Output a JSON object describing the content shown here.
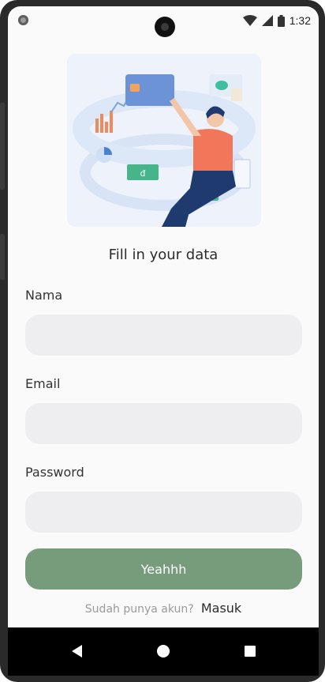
{
  "status_bar": {
    "time": "1:32",
    "icons": [
      "wifi-icon",
      "signal-icon",
      "battery-icon"
    ]
  },
  "form": {
    "title": "Fill in your data",
    "fields": [
      {
        "label": "Nama",
        "value": "",
        "placeholder": ""
      },
      {
        "label": "Email",
        "value": "",
        "placeholder": ""
      },
      {
        "label": "Password",
        "value": "",
        "placeholder": ""
      }
    ],
    "submit_label": "Yeahhh",
    "login_prompt": "Sudah punya akun?",
    "login_link": "Masuk"
  },
  "colors": {
    "accent": "#769c7c",
    "input_bg": "#eeeef1",
    "background": "#fafafa"
  },
  "nav_bar": {
    "icons": [
      "back-icon",
      "home-icon",
      "recents-icon"
    ]
  }
}
